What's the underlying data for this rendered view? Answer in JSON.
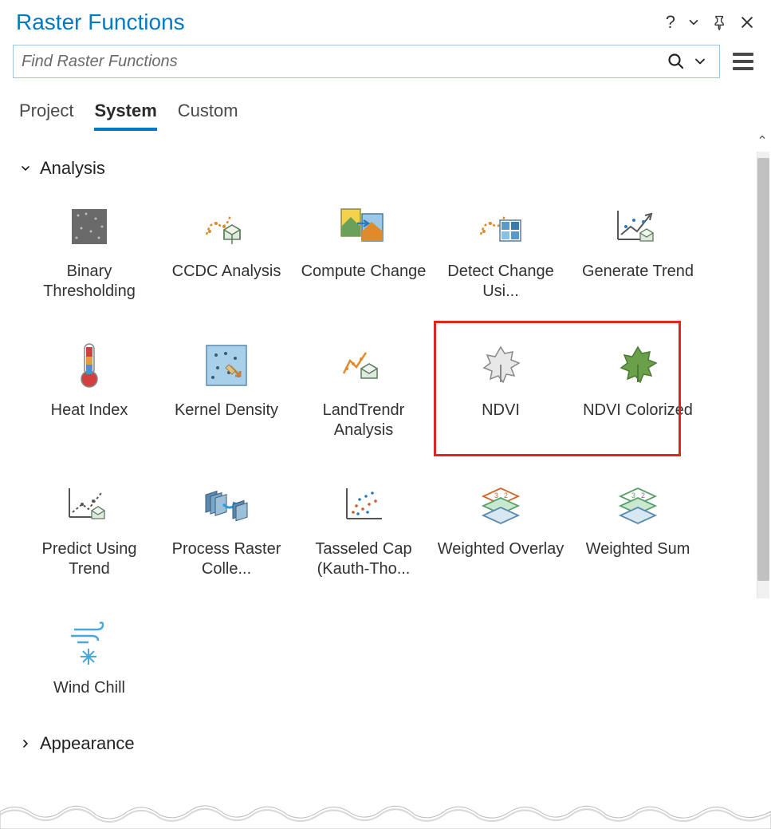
{
  "panel": {
    "title": "Raster Functions"
  },
  "search": {
    "placeholder": "Find Raster Functions"
  },
  "tabs": {
    "project": "Project",
    "system": "System",
    "custom": "Custom",
    "active": "system"
  },
  "categories": {
    "analysis": {
      "label": "Analysis",
      "expanded": true,
      "items": [
        "Binary Thresholding",
        "CCDC Analysis",
        "Compute Change",
        "Detect Change Usi...",
        "Generate Trend",
        "Heat Index",
        "Kernel Density",
        "LandTrendr Analysis",
        "NDVI",
        "NDVI Colorized",
        "Predict Using Trend",
        "Process Raster Colle...",
        "Tasseled Cap (Kauth-Tho...",
        "Weighted Overlay",
        "Weighted Sum",
        "Wind Chill"
      ]
    },
    "appearance": {
      "label": "Appearance",
      "expanded": false
    }
  },
  "icons": {
    "help": "?",
    "dropdown": "chevron",
    "pin": "pin",
    "close": "close",
    "menu": "hamburger"
  },
  "highlight": {
    "items": [
      "NDVI",
      "NDVI Colorized"
    ]
  }
}
